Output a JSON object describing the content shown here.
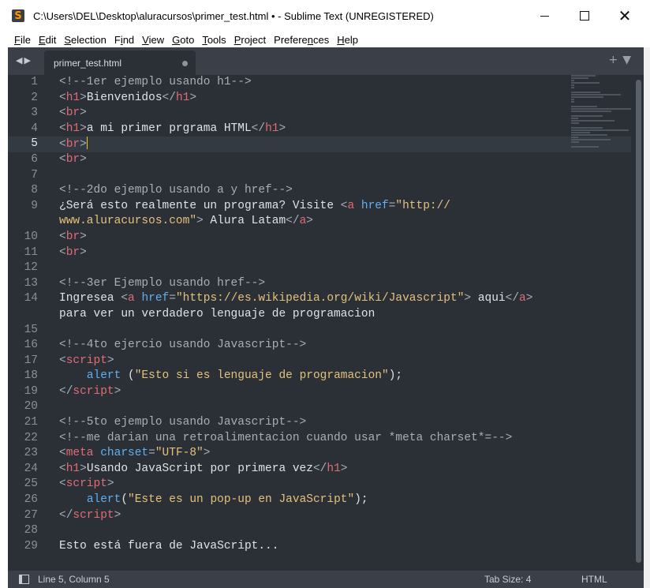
{
  "window": {
    "title": "C:\\Users\\DEL\\Desktop\\aluracursos\\primer_test.html • - Sublime Text (UNREGISTERED)",
    "app_icon": "sublime-text-icon"
  },
  "menu": [
    {
      "pre": "",
      "ul": "F",
      "post": "ile"
    },
    {
      "pre": "",
      "ul": "E",
      "post": "dit"
    },
    {
      "pre": "",
      "ul": "S",
      "post": "election"
    },
    {
      "pre": "F",
      "ul": "i",
      "post": "nd"
    },
    {
      "pre": "",
      "ul": "V",
      "post": "iew"
    },
    {
      "pre": "",
      "ul": "G",
      "post": "oto"
    },
    {
      "pre": "",
      "ul": "T",
      "post": "ools"
    },
    {
      "pre": "",
      "ul": "P",
      "post": "roject"
    },
    {
      "pre": "Prefere",
      "ul": "n",
      "post": "ces"
    },
    {
      "pre": "",
      "ul": "H",
      "post": "elp"
    }
  ],
  "tab": {
    "label": "primer_test.html",
    "modified": true
  },
  "current_line": 5,
  "lines": [
    {
      "n": "1",
      "t": [
        [
          "cm",
          "<!--1er ejemplo usando h1-->"
        ]
      ]
    },
    {
      "n": "2",
      "t": [
        [
          "pn",
          "<"
        ],
        [
          "tg",
          "h1"
        ],
        [
          "pn",
          ">"
        ],
        [
          "tx",
          "Bienvenidos"
        ],
        [
          "pn",
          "</"
        ],
        [
          "tg",
          "h1"
        ],
        [
          "pn",
          ">"
        ]
      ]
    },
    {
      "n": "3",
      "t": [
        [
          "pn",
          "<"
        ],
        [
          "tg",
          "br"
        ],
        [
          "pn",
          ">"
        ]
      ]
    },
    {
      "n": "4",
      "t": [
        [
          "pn",
          "<"
        ],
        [
          "tg",
          "h1"
        ],
        [
          "pn",
          ">"
        ],
        [
          "tx",
          "a mi primer prgrama HTML"
        ],
        [
          "pn",
          "</"
        ],
        [
          "tg",
          "h1"
        ],
        [
          "pn",
          ">"
        ]
      ]
    },
    {
      "n": "5",
      "t": [
        [
          "pn",
          "<"
        ],
        [
          "tg",
          "br"
        ],
        [
          "pn",
          ">"
        ]
      ],
      "caret": true
    },
    {
      "n": "6",
      "t": [
        [
          "pn",
          "<"
        ],
        [
          "tg",
          "br"
        ],
        [
          "pn",
          ">"
        ]
      ]
    },
    {
      "n": "7",
      "t": []
    },
    {
      "n": "8",
      "t": [
        [
          "cm",
          "<!--2do ejemplo usando a y href-->"
        ]
      ]
    },
    {
      "n": "9",
      "t": [
        [
          "tx",
          "¿Será esto realmente un programa? Visite "
        ],
        [
          "pn",
          "<"
        ],
        [
          "tg",
          "a"
        ],
        [
          "tx",
          " "
        ],
        [
          "at",
          "href"
        ],
        [
          "pn",
          "="
        ],
        [
          "st",
          "\"http://"
        ]
      ]
    },
    {
      "n": "",
      "t": [
        [
          "st",
          "www.aluracursos.com\""
        ],
        [
          "pn",
          ">"
        ],
        [
          "tx",
          " Alura Latam"
        ],
        [
          "pn",
          "</"
        ],
        [
          "tg",
          "a"
        ],
        [
          "pn",
          ">"
        ]
      ]
    },
    {
      "n": "10",
      "t": [
        [
          "pn",
          "<"
        ],
        [
          "tg",
          "br"
        ],
        [
          "pn",
          ">"
        ]
      ]
    },
    {
      "n": "11",
      "t": [
        [
          "pn",
          "<"
        ],
        [
          "tg",
          "br"
        ],
        [
          "pn",
          ">"
        ]
      ]
    },
    {
      "n": "12",
      "t": []
    },
    {
      "n": "13",
      "t": [
        [
          "cm",
          "<!--3er Ejemplo usando href-->"
        ]
      ]
    },
    {
      "n": "14",
      "t": [
        [
          "tx",
          "Ingresea "
        ],
        [
          "pn",
          "<"
        ],
        [
          "tg",
          "a"
        ],
        [
          "tx",
          " "
        ],
        [
          "at",
          "href"
        ],
        [
          "pn",
          "="
        ],
        [
          "st",
          "\"https://es.wikipedia.org/wiki/Javascript\""
        ],
        [
          "pn",
          ">"
        ],
        [
          "tx",
          " aqui"
        ],
        [
          "pn",
          "</"
        ],
        [
          "tg",
          "a"
        ],
        [
          "pn",
          ">"
        ]
      ]
    },
    {
      "n": "",
      "t": [
        [
          "tx",
          "para ver un verdadero lenguaje de programacion"
        ]
      ]
    },
    {
      "n": "15",
      "t": []
    },
    {
      "n": "16",
      "t": [
        [
          "cm",
          "<!--4to ejercio usando Javascript-->"
        ]
      ]
    },
    {
      "n": "17",
      "t": [
        [
          "pn",
          "<"
        ],
        [
          "tg",
          "script"
        ],
        [
          "pn",
          ">"
        ]
      ]
    },
    {
      "n": "18",
      "t": [
        [
          "tx",
          "    "
        ],
        [
          "at",
          "alert"
        ],
        [
          "tx",
          " ("
        ],
        [
          "st",
          "\"Esto si es lenguaje de programacion\""
        ],
        [
          "tx",
          ");"
        ]
      ]
    },
    {
      "n": "19",
      "t": [
        [
          "pn",
          "</"
        ],
        [
          "tg",
          "script"
        ],
        [
          "pn",
          ">"
        ]
      ]
    },
    {
      "n": "20",
      "t": []
    },
    {
      "n": "21",
      "t": [
        [
          "cm",
          "<!--5to ejemplo usando Javascript-->"
        ]
      ]
    },
    {
      "n": "22",
      "t": [
        [
          "cm",
          "<!--me darian una retroalimentacion cuando usar *meta charset*=-->"
        ]
      ]
    },
    {
      "n": "23",
      "t": [
        [
          "pn",
          "<"
        ],
        [
          "tg",
          "meta"
        ],
        [
          "tx",
          " "
        ],
        [
          "at",
          "charset"
        ],
        [
          "pn",
          "="
        ],
        [
          "st",
          "\"UTF-8\""
        ],
        [
          "pn",
          ">"
        ]
      ]
    },
    {
      "n": "24",
      "t": [
        [
          "pn",
          "<"
        ],
        [
          "tg",
          "h1"
        ],
        [
          "pn",
          ">"
        ],
        [
          "tx",
          "Usando JavaScript por primera vez"
        ],
        [
          "pn",
          "</"
        ],
        [
          "tg",
          "h1"
        ],
        [
          "pn",
          ">"
        ]
      ]
    },
    {
      "n": "25",
      "t": [
        [
          "pn",
          "<"
        ],
        [
          "tg",
          "script"
        ],
        [
          "pn",
          ">"
        ]
      ]
    },
    {
      "n": "26",
      "t": [
        [
          "tx",
          "    "
        ],
        [
          "at",
          "alert"
        ],
        [
          "tx",
          "("
        ],
        [
          "st",
          "\"Este es un pop-up en JavaScript\""
        ],
        [
          "tx",
          ");"
        ]
      ]
    },
    {
      "n": "27",
      "t": [
        [
          "pn",
          "</"
        ],
        [
          "tg",
          "script"
        ],
        [
          "pn",
          ">"
        ]
      ]
    },
    {
      "n": "28",
      "t": []
    },
    {
      "n": "29",
      "t": [
        [
          "tx",
          "Esto está fuera de JavaScript..."
        ]
      ]
    }
  ],
  "status": {
    "position": "Line 5, Column 5",
    "tab_size": "Tab Size: 4",
    "syntax": "HTML"
  },
  "colors": {
    "editor_bg": "#2b3036",
    "tag": "#e06c75",
    "attribute": "#61afef",
    "string": "#e5c07b",
    "comment": "#a8aeb6",
    "caret": "#f5c518"
  }
}
